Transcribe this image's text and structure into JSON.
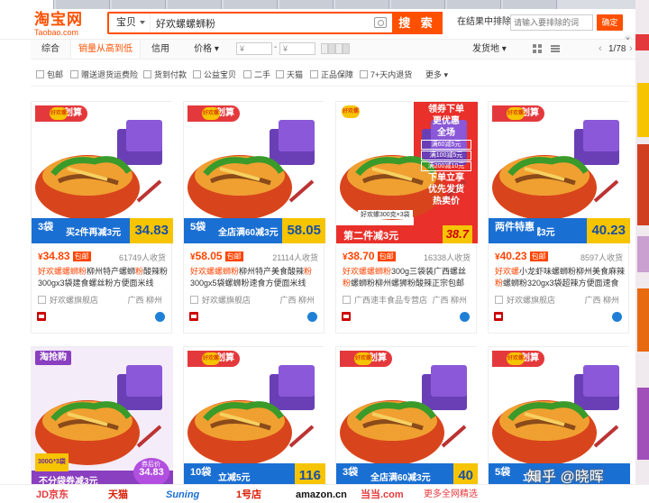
{
  "browser_tabs": [
    "",
    "",
    "",
    "",
    "",
    "",
    "",
    "",
    "",
    ""
  ],
  "header": {
    "logo_cn": "淘宝网",
    "logo_en": "Taobao.com",
    "search_scope": "宝贝",
    "search_query": "好欢螺螺蛳粉",
    "search_button": "搜 索",
    "in_result_label": "在结果中排除",
    "in_result_placeholder": "请输入要排除的词",
    "confirm_button": "确定"
  },
  "sort": {
    "tabs": [
      "综合",
      "销量从高到低",
      "信用",
      "价格"
    ],
    "active_tab": "销量从高到低",
    "price_from": "¥",
    "price_to": "¥",
    "price_dash": "-",
    "ship_from": "发货地",
    "page_indicator": "1/78",
    "prev_arrow": "‹",
    "next_arrow": "›"
  },
  "filters": [
    "包邮",
    "赠送退货运费险",
    "货到付款",
    "公益宝贝",
    "二手",
    "天猫",
    "正品保障",
    "7+天内退货",
    "更多"
  ],
  "close_label": "×",
  "products": [
    {
      "price": "34.83",
      "currency": "¥",
      "free_ship": "包邮",
      "sold": "61749人收货",
      "title_hl1": "好欢螺螺蛳粉",
      "title_rest1": "柳州特产螺蛳",
      "title_hl2": "粉",
      "title_rest2": "酸辣粉300gx3袋建食螺丝粉方便面米线",
      "shop": "好欢螺旗舰店",
      "location": "广西 柳州",
      "img_banner": "买2件再减3元",
      "img_price": "34.83",
      "img_bag": "3袋",
      "img_brand": "好欢螺",
      "img_logo": "聚划算"
    },
    {
      "price": "58.05",
      "currency": "¥",
      "free_ship": "包邮",
      "sold": "21114人收货",
      "title_hl1": "好欢螺螺蛳粉",
      "title_rest1": "柳州特产美食酸辣",
      "title_hl2": "粉",
      "title_rest2": "300gx5袋螺蛳粉速食方便面米线",
      "shop": "好欢螺旗舰店",
      "location": "广西 柳州",
      "img_banner": "全店满60减3元",
      "img_price": "58.05",
      "img_bag": "5袋",
      "img_brand": "好欢螺",
      "img_logo": "聚划算"
    },
    {
      "price": "38.70",
      "currency": "¥",
      "free_ship": "包邮",
      "sold": "16338人收货",
      "title_hl1": "好欢螺螺蛳粉",
      "title_rest1": "300g三袋装广西螺丝",
      "title_hl2": "粉",
      "title_rest2": "螺蛳粉柳州螺狮粉酸辣正宗包邮",
      "shop": "广西速丰食品专营店",
      "location": "广西 柳州",
      "img_banner": "第二件减3元",
      "img_price": "38.7",
      "img_bag": "好欢螺300克×3袋",
      "img_brand": "好欢螺",
      "img_promo": [
        "领券下单",
        "更优惠",
        "全场",
        "满60减5元",
        "满100减5元",
        "满200减10元",
        "下单立享",
        "优先发货",
        "热卖价"
      ]
    },
    {
      "price": "40.23",
      "currency": "¥",
      "free_ship": "包邮",
      "sold": "8597人收货",
      "title_hl1": "好欢螺",
      "title_rest1": "小龙虾味螺蛳粉柳州美食麻辣",
      "title_hl2": "粉",
      "title_rest2": "螺蛳粉320gx3袋超辣方便面速食",
      "shop": "好欢螺旗舰店",
      "location": "广西 柳州",
      "img_banner": "立减3元",
      "img_price": "40.23",
      "img_bag": "两件特惠",
      "img_brand": "好欢螺",
      "img_logo": "聚划算"
    },
    {
      "img_banner": "不分袋券减3元",
      "img_price": "34.83",
      "img_bag": "300G*3袋",
      "img_brand": "淘抢购",
      "img_tag": "券后价"
    },
    {
      "img_banner": "立减5元",
      "img_price": "116",
      "img_bag": "10袋",
      "img_brand": "好欢螺",
      "img_logo": "聚划算"
    },
    {
      "img_banner": "全店满60减3元",
      "img_price": "40",
      "img_bag": "3袋",
      "img_brand": "好欢螺",
      "img_logo": "聚划算"
    },
    {
      "img_banner": "立减",
      "img_price": "",
      "img_bag": "5袋",
      "img_brand": "好欢螺",
      "img_logo": "聚划算"
    }
  ],
  "bottom_malls": [
    "JD京东",
    "天猫",
    "Suning",
    "1号店",
    "amazon.cn",
    "当当.com",
    "更多全网精选"
  ],
  "watermark": "知乎 @晓晖",
  "colors": {
    "accent": "#ff5000",
    "price": "#ff4400",
    "juhuasuan": "#e4393c",
    "banner_blue": "#1a6fd3"
  }
}
